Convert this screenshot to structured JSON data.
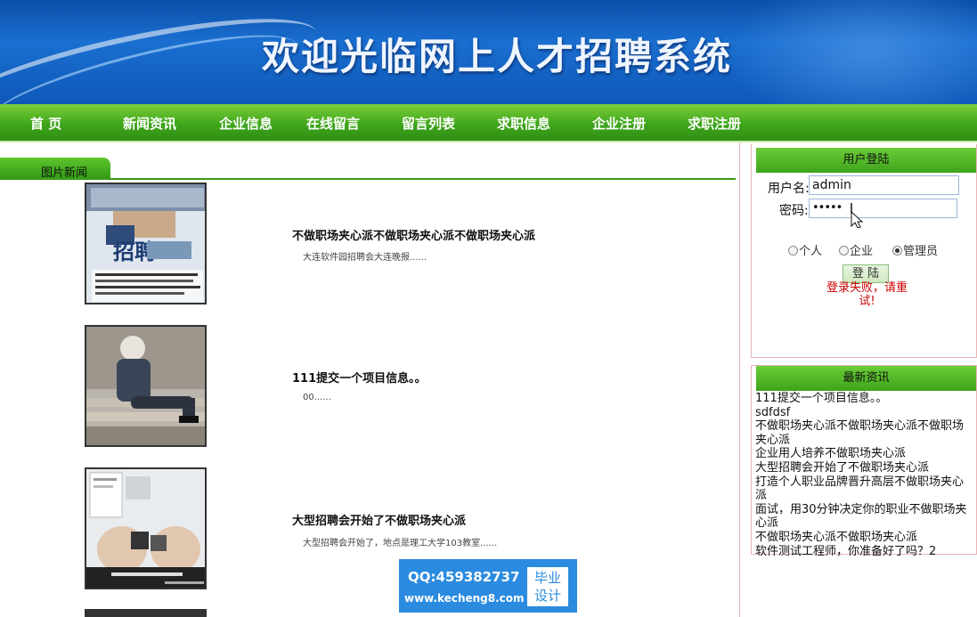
{
  "header": {
    "title": "欢迎光临网上人才招聘系统"
  },
  "nav": {
    "items": [
      "首 页",
      "新闻资讯",
      "企业信息",
      "在线留言",
      "留言列表",
      "求职信息",
      "企业注册",
      "求职注册"
    ]
  },
  "picture_news": {
    "tab_label": "图片新闻",
    "items": [
      {
        "title": "不做职场夹心派不做职场夹心派不做职场夹心派",
        "summary": "大连软件园招聘会大连晚报......",
        "image": "recruitment-poster"
      },
      {
        "title": "111提交一个项目信息。。",
        "summary": "00......",
        "image": "person-sitting-on-bench"
      },
      {
        "title": "大型招聘会开始了不做职场夹心派",
        "summary": "大型招聘会开始了，地点是理工大学103教室......",
        "image": "hands-holding-cubes-poster"
      }
    ]
  },
  "login": {
    "heading": "用户登陆",
    "username_label": "用户名:",
    "username_value": "admin",
    "password_label": "密码:",
    "password_value": "•••••",
    "roles": [
      "个人",
      "企业",
      "管理员"
    ],
    "selected_role": "管理员",
    "submit_label": "登 陆",
    "error_text": "登录失败，请重试!"
  },
  "latest_news": {
    "heading": "最新资讯",
    "items": [
      "111提交一个项目信息。。",
      "sdfdsf",
      "不做职场夹心派不做职场夹心派不做职场夹心派",
      "企业用人培养不做职场夹心派",
      "大型招聘会开始了不做职场夹心派",
      "打造个人职业品牌晋升高层不做职场夹心派",
      "面试，用30分钟决定你的职业不做职场夹心派",
      "不做职场夹心派不做职场夹心派",
      "软件测试工程师，你准备好了吗？2"
    ]
  },
  "watermark": {
    "qq": "QQ:459382737",
    "url": "www.kecheng8.com",
    "badge_line1": "毕业",
    "badge_line2": "设计"
  },
  "colors": {
    "banner_blue": "#0e58b8",
    "nav_green": "#3fa51c",
    "error_red": "#cc0000",
    "watermark_blue": "#2b8be0"
  }
}
